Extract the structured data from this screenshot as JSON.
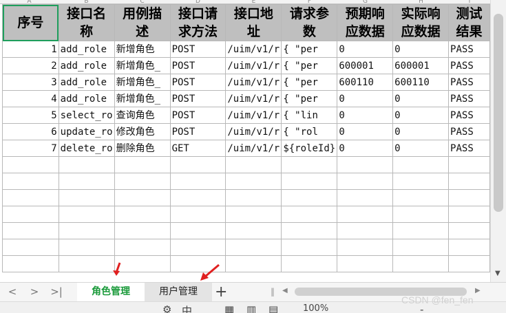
{
  "col_letters": [
    "A",
    "B",
    "C",
    "D",
    "E",
    "F",
    "G",
    "H",
    "I"
  ],
  "headers": [
    "序号",
    "接口名称",
    "用例描述",
    "接口请求方法",
    "接口地址",
    "请求参数",
    "预期响应数据",
    "实际响应数据",
    "测试结果"
  ],
  "rows": [
    [
      "1",
      "add_role",
      "新增角色",
      "POST",
      "/uim/v1/r",
      "{    \"per",
      "0",
      "0",
      "PASS"
    ],
    [
      "2",
      "add_role",
      "新增角色_",
      "POST",
      "/uim/v1/r",
      "{    \"per",
      "600001",
      "600001",
      "PASS"
    ],
    [
      "3",
      "add_role",
      "新增角色_",
      "POST",
      "/uim/v1/r",
      "{    \"per",
      "600110",
      "600110",
      "PASS"
    ],
    [
      "4",
      "add_role",
      "新增角色_",
      "POST",
      "/uim/v1/r",
      "{    \"per",
      "0",
      "0",
      "PASS"
    ],
    [
      "5",
      "select_ro",
      "查询角色",
      "POST",
      "/uim/v1/r",
      "{    \"lin",
      "0",
      "0",
      "PASS"
    ],
    [
      "6",
      "update_ro",
      "修改角色",
      "POST",
      "/uim/v1/r",
      "{    \"rol",
      "0",
      "0",
      "PASS"
    ],
    [
      "7",
      "delete_ro",
      "删除角色",
      "GET",
      "/uim/v1/r",
      "${roleId}",
      "0",
      "0",
      "PASS"
    ]
  ],
  "tabs": {
    "nav_first": "<",
    "nav_prev": "<",
    "nav_next": ">",
    "nav_last": ">|",
    "active": "角色管理",
    "other": "用户管理",
    "add": "+"
  },
  "status": {
    "zoom": "100%",
    "zoom_out": "-",
    "view_mode": "中"
  },
  "watermark": "CSDN @fen_fen",
  "colors": {
    "header_bg": "#bfbfbf",
    "selected_border": "#1e9e5c",
    "active_tab_text": "#1a9a3a",
    "arrow": "#e02020"
  }
}
